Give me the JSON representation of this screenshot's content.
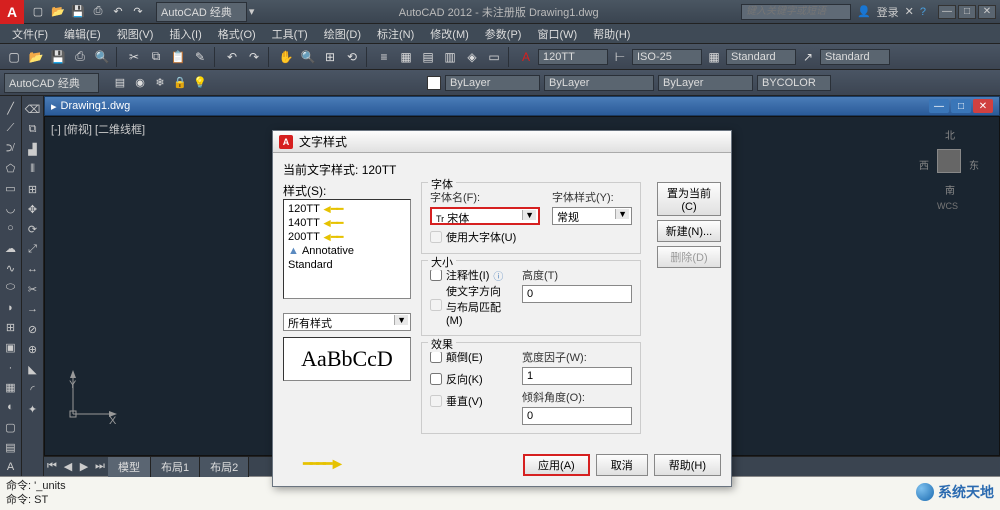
{
  "app": {
    "logo": "A",
    "workspace": "AutoCAD 经典",
    "title": "AutoCAD 2012 - 未注册版    Drawing1.dwg",
    "search_placeholder": "键入关键字或短语",
    "login": "登录"
  },
  "menu": [
    "文件(F)",
    "编辑(E)",
    "视图(V)",
    "插入(I)",
    "格式(O)",
    "工具(T)",
    "绘图(D)",
    "标注(N)",
    "修改(M)",
    "参数(P)",
    "窗口(W)",
    "帮助(H)"
  ],
  "toolbar2": {
    "style": "120TT",
    "dim": "ISO-25",
    "std1": "Standard",
    "std2": "Standard"
  },
  "props": {
    "workspace": "AutoCAD 经典",
    "layer": "ByLayer",
    "linetype": "ByLayer",
    "lineweight": "ByLayer",
    "color": "BYCOLOR"
  },
  "doc": {
    "title": "Drawing1.dwg",
    "view_label": "[-] [俯视] [二维线框]"
  },
  "viewcube": {
    "n": "北",
    "s": "南",
    "e": "东",
    "w": "西",
    "wcs": "WCS"
  },
  "ucs": {
    "x": "X",
    "y": "Y"
  },
  "tabs": [
    "模型",
    "布局1",
    "布局2"
  ],
  "cmd": {
    "line1": "命令: '_units",
    "line2": "命令: ST"
  },
  "dialog": {
    "title": "文字样式",
    "current_label": "当前文字样式:",
    "current_value": "120TT",
    "style_list_label": "样式(S):",
    "styles": [
      "120TT",
      "140TT",
      "200TT",
      "Annotative",
      "Standard"
    ],
    "filter": "所有样式",
    "preview": "AaBbCcD",
    "font_group": "字体",
    "font_name_label": "字体名(F):",
    "font_name": "宋体",
    "font_style_label": "字体样式(Y):",
    "font_style": "常规",
    "use_bigfont": "使用大字体(U)",
    "size_group": "大小",
    "annotative": "注释性(I)",
    "match_orient": "使文字方向与布局匹配(M)",
    "height_label": "高度(T)",
    "height": "0",
    "effects_group": "效果",
    "upside_down": "颠倒(E)",
    "backwards": "反向(K)",
    "vertical": "垂直(V)",
    "width_factor_label": "宽度因子(W):",
    "width_factor": "1",
    "oblique_label": "倾斜角度(O):",
    "oblique": "0",
    "btn_current": "置为当前(C)",
    "btn_new": "新建(N)...",
    "btn_delete": "删除(D)",
    "btn_apply": "应用(A)",
    "btn_cancel": "取消",
    "btn_help": "帮助(H)"
  },
  "watermark": "系统天地"
}
